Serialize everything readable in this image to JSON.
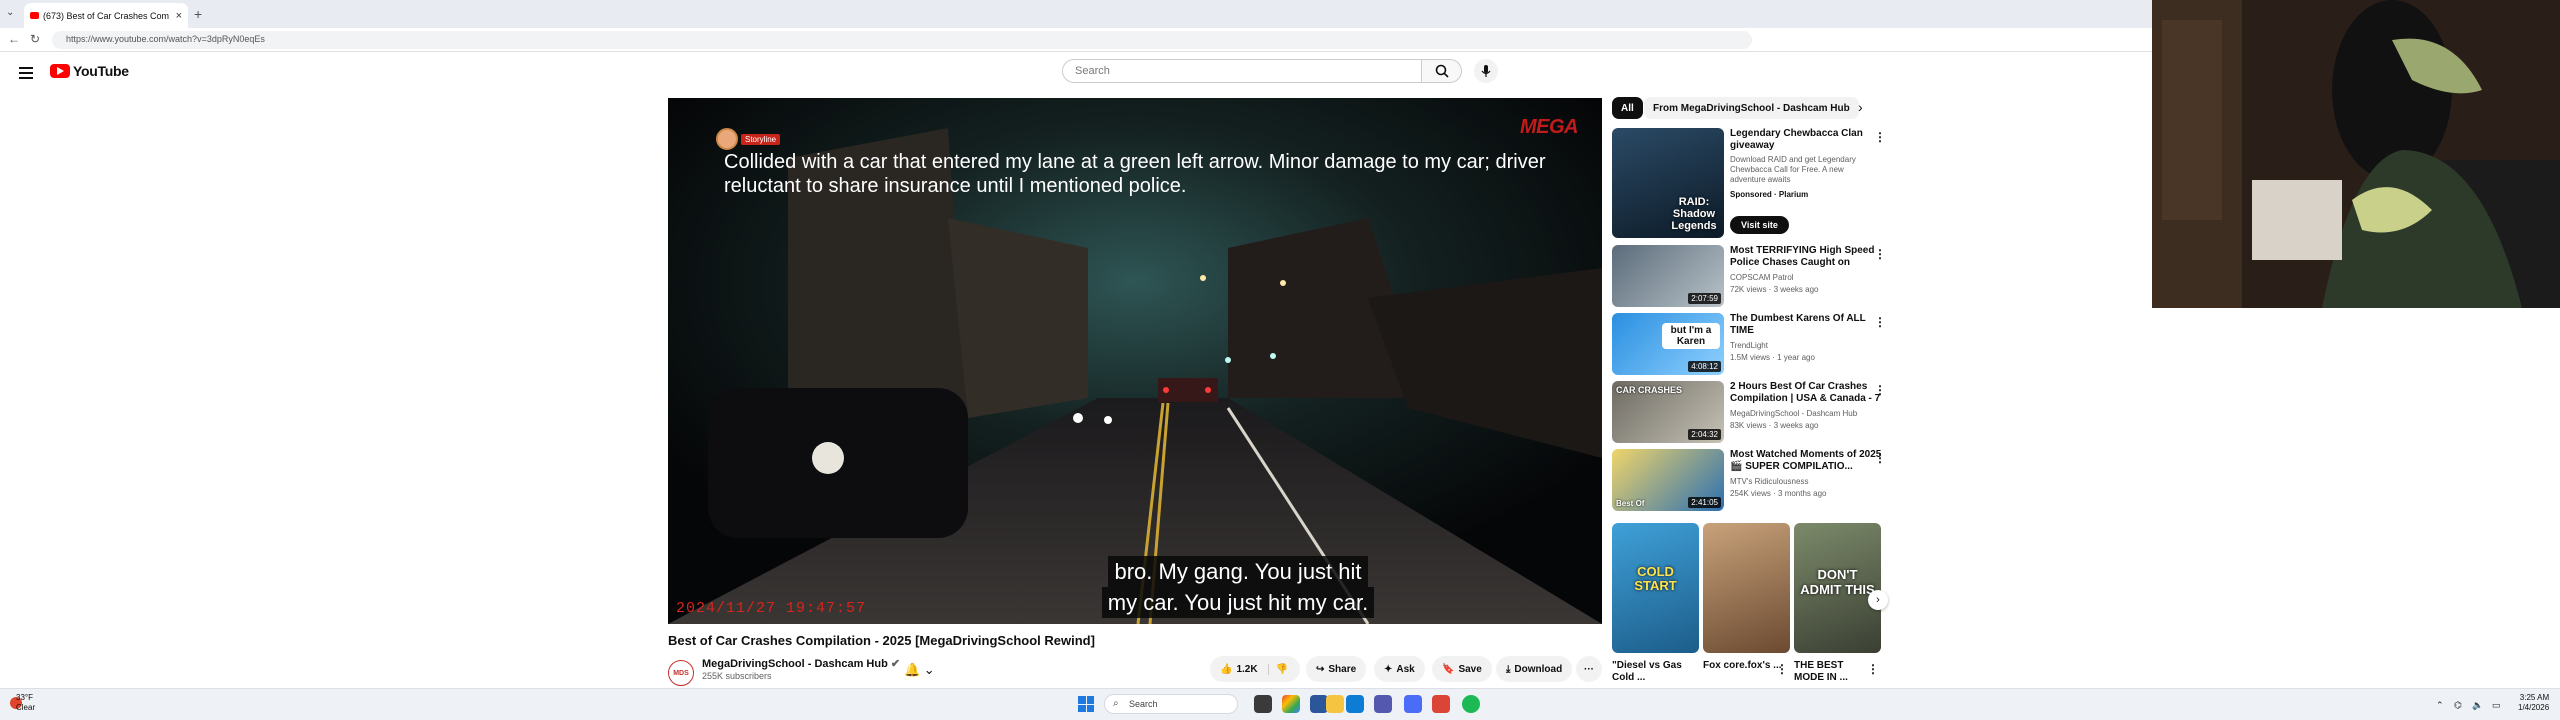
{
  "browser": {
    "tab_title": "(673) Best of Car Crashes Com",
    "url": "https://www.youtube.com/watch?v=3dpRyN0eqEs",
    "new_tab_symbol": "+"
  },
  "header": {
    "logo_text": "YouTube",
    "search_placeholder": "Search"
  },
  "video": {
    "channel_tag": "Storyline",
    "watermark": "MEGA",
    "top_caption": "Collided with a car that entered my lane at a green left arrow. Minor damage to my car; driver reluctant to share insurance until I mentioned police.",
    "subtitle_line1": "bro. My gang. You just hit",
    "subtitle_line2": "my car. You just hit my car.",
    "timestamp": "2024/11/27 19:47:57",
    "title": "Best of Car Crashes Compilation - 2025 [MegaDrivingSchool Rewind]",
    "channel_name": "MegaDrivingSchool - Dashcam Hub",
    "channel_avatar_text": "MDS",
    "subscribers": "255K subscribers",
    "like_count": "1.2K",
    "share_label": "Share",
    "ask_label": "Ask",
    "save_label": "Save",
    "download_label": "Download",
    "more_label": "···"
  },
  "sidebar": {
    "chips": [
      "All",
      "From MegaDrivingSchool - Dashcam Hub"
    ],
    "recommendations": [
      {
        "title": "Legendary Chewbacca Clan giveaway",
        "thumb_text": "RAID: Shadow Legends",
        "channel": "Download RAID and get Legendary Chewbacca Call for Free. A new adventure awaits",
        "meta": "Sponsored · Plarium",
        "visit_label": "Visit site",
        "duration": ""
      },
      {
        "title": "Most TERRIFYING High Speed Police Chases Caught on Dash...",
        "thumb_text": "",
        "channel": "COPSCAM Patrol",
        "meta": "72K views · 3 weeks ago",
        "duration": "2:07:59"
      },
      {
        "title": "The Dumbest Karens Of ALL TIME",
        "thumb_text": "but I'm a Karen",
        "channel": "TrendLight",
        "meta": "1.5M views · 1 year ago",
        "duration": "4:08:12"
      },
      {
        "title": "2 Hours Best Of Car Crashes Compilation | USA & Canada - 7",
        "thumb_text": "CAR CRASHES",
        "channel": "MegaDrivingSchool - Dashcam Hub",
        "meta": "83K views · 3 weeks ago",
        "duration": "2:04:32"
      },
      {
        "title": "Most Watched Moments of 2025 🎬 SUPER COMPILATIO...",
        "thumb_text": "Best Of",
        "channel": "MTV's Ridiculousness",
        "meta": "254K views · 3 months ago",
        "duration": "2:41:05"
      }
    ],
    "shorts": [
      {
        "title": "\"Diesel vs Gas Cold ...",
        "thumb_text": "COLD START"
      },
      {
        "title": "Fox core.fox's ...",
        "thumb_text": ""
      },
      {
        "title": "THE BEST MODE IN ...",
        "thumb_text": "DON'T ADMIT THIS"
      }
    ]
  },
  "taskbar": {
    "temperature": "33°F",
    "weather": "Clear",
    "search_label": "Search",
    "time": "3:25 AM",
    "date": "1/4/2026"
  }
}
